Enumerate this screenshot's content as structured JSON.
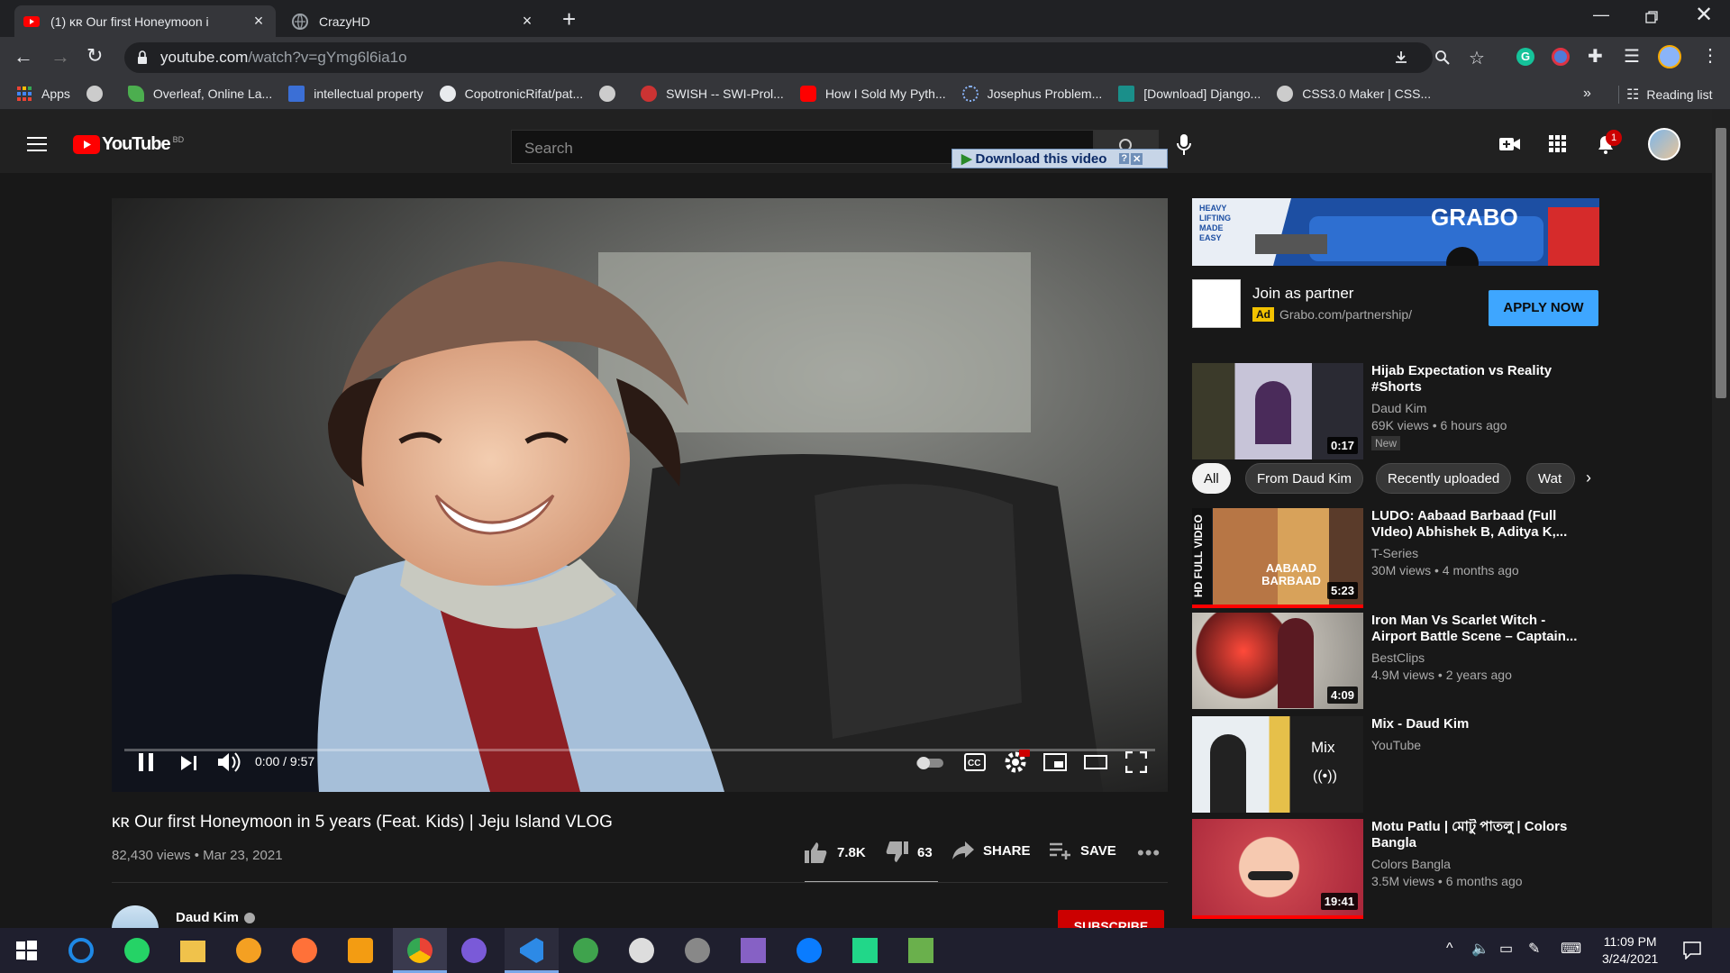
{
  "browser": {
    "tabs": [
      {
        "title": "(1) ᴋʀ Our first Honeymoon i",
        "active": true,
        "audio": true
      },
      {
        "title": "CrazyHD",
        "active": false
      }
    ],
    "new_tab": "+",
    "url": {
      "host": "youtube.com",
      "path": "/watch?v=gYmg6l6ia1o"
    },
    "bookmarks": [
      {
        "label": "Apps",
        "icon": "apps-grid-icon"
      },
      {
        "label": "",
        "icon": "globe-icon"
      },
      {
        "label": "Overleaf, Online La...",
        "icon": "overleaf-icon"
      },
      {
        "label": "intellectual property",
        "icon": "s-square-icon"
      },
      {
        "label": "CopotronicRifat/pat...",
        "icon": "github-icon"
      },
      {
        "label": "",
        "icon": "globe-icon"
      },
      {
        "label": "SWISH -- SWI-Prol...",
        "icon": "swish-icon"
      },
      {
        "label": "How I Sold My Pyth...",
        "icon": "youtube-icon"
      },
      {
        "label": "Josephus Problem...",
        "icon": "dotted-circle-icon"
      },
      {
        "label": "[Download] Django...",
        "icon": "django-icon"
      },
      {
        "label": "CSS3.0 Maker | CSS...",
        "icon": "globe-icon"
      }
    ],
    "more": "»",
    "reading_list": "Reading list"
  },
  "youtube": {
    "logo_text": "YouTube",
    "country": "BD",
    "search_placeholder": "Search",
    "download_button": "Download this video",
    "notifications_count": "1",
    "video": {
      "title": "ᴋʀ Our first Honeymoon in 5 years (Feat. Kids) | Jeju Island VLOG",
      "views": "82,430 views",
      "date": "Mar 23, 2021",
      "time": "0:00 / 9:57",
      "progress": 0,
      "likes": "7.8K",
      "dislikes": "63",
      "share": "SHARE",
      "save": "SAVE"
    },
    "channel": {
      "name": "Daud Kim",
      "subscribe": "SUBSCRIBE"
    },
    "ad": {
      "brand": "GRABO",
      "tag": "HEAVY LIFTING MADE EASY",
      "title": "Join as partner",
      "badge": "Ad",
      "url": "Grabo.com/partnership/",
      "cta": "APPLY NOW"
    },
    "chips": [
      "All",
      "From Daud Kim",
      "Recently uploaded",
      "Wat"
    ],
    "sidebar": [
      {
        "title": "Hijab Expectation vs Reality #Shorts",
        "channel": "Daud Kim",
        "stats": "69K views • 6 hours ago",
        "badge": "New",
        "duration": "0:17"
      },
      {
        "title": "LUDO: Aabaad Barbaad (Full VIdeo) Abhishek B, Aditya K,...",
        "channel": "T-Series",
        "stats": "30M views • 4 months ago",
        "duration": "5:23",
        "thumb_text": "AABAAD BARBAAD",
        "side_text": "HD FULL VIDEO"
      },
      {
        "title": "Iron Man Vs Scarlet Witch - Airport Battle Scene – Captain...",
        "channel": "BestClips",
        "stats": "4.9M views • 2 years ago",
        "duration": "4:09"
      },
      {
        "title": "Mix - Daud Kim",
        "channel": "YouTube",
        "stats": "",
        "duration": "",
        "overlay": "Mix"
      },
      {
        "title": "Motu Patlu | মোটু পাতলু | Colors Bangla",
        "channel": "Colors Bangla",
        "stats": "3.5M views • 6 months ago",
        "duration": "19:41"
      }
    ]
  },
  "taskbar": {
    "time": "11:09 PM",
    "date": "3/24/2021"
  }
}
